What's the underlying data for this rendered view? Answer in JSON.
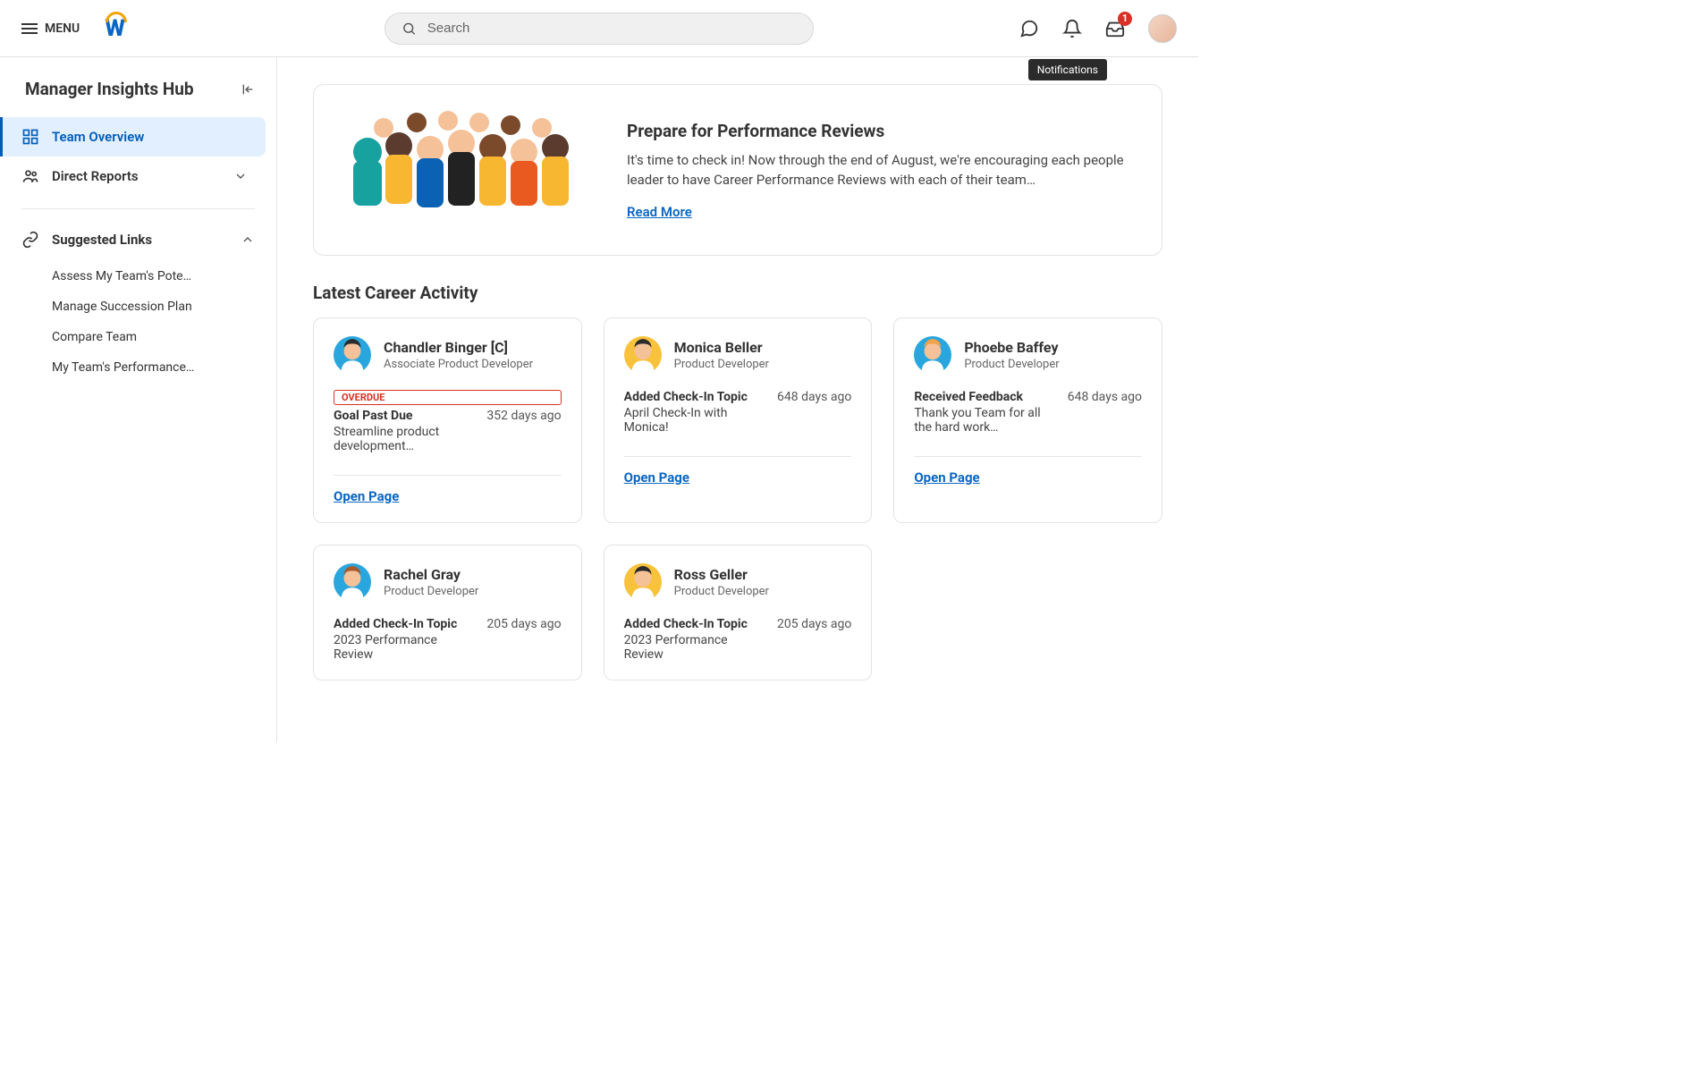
{
  "header": {
    "menu_label": "MENU",
    "search_placeholder": "Search",
    "tooltip": "Notifications",
    "inbox_badge": "1"
  },
  "sidebar": {
    "title": "Manager Insights Hub",
    "items": [
      {
        "label": "Team Overview"
      },
      {
        "label": "Direct Reports"
      }
    ],
    "suggested_title": "Suggested Links",
    "suggested": [
      {
        "label": "Assess My Team's Pote…"
      },
      {
        "label": "Manage Succession Plan"
      },
      {
        "label": "Compare Team"
      },
      {
        "label": "My Team's Performance…"
      }
    ]
  },
  "banner": {
    "title": "Prepare for Performance Reviews",
    "body": "It's time to check in! Now through the end of August, we're encouraging each people leader to have Career Performance Reviews with each of their team…",
    "read_more": "Read More"
  },
  "section_title": "Latest Career Activity",
  "open_page_label": "Open Page",
  "activities": [
    {
      "name": "Chandler Binger [C]",
      "role": "Associate Product Developer",
      "overdue": "OVERDUE",
      "title": "Goal Past Due",
      "desc": "Streamline product development…",
      "days": "352 days ago",
      "avatar_bg": "#2aa6de",
      "hair": "#2b2b2b"
    },
    {
      "name": "Monica Beller",
      "role": "Product Developer",
      "title": "Added Check-In Topic",
      "desc": "April Check-In with Monica!",
      "days": "648 days ago",
      "avatar_bg": "#f8c23b",
      "hair": "#2b2b2b"
    },
    {
      "name": "Phoebe Baffey",
      "role": "Product Developer",
      "title": "Received Feedback",
      "desc": "Thank you Team for all the hard work…",
      "days": "648 days ago",
      "avatar_bg": "#2aa6de",
      "hair": "#f3a24a"
    },
    {
      "name": "Rachel Gray",
      "role": "Product Developer",
      "title": "Added Check-In Topic",
      "desc": "2023 Performance Review",
      "days": "205 days ago",
      "avatar_bg": "#2aa6de",
      "hair": "#a85a2f"
    },
    {
      "name": "Ross Geller",
      "role": "Product Developer",
      "title": "Added Check-In Topic",
      "desc": "2023 Performance Review",
      "days": "205 days ago",
      "avatar_bg": "#f8c23b",
      "hair": "#2b2b2b"
    }
  ]
}
